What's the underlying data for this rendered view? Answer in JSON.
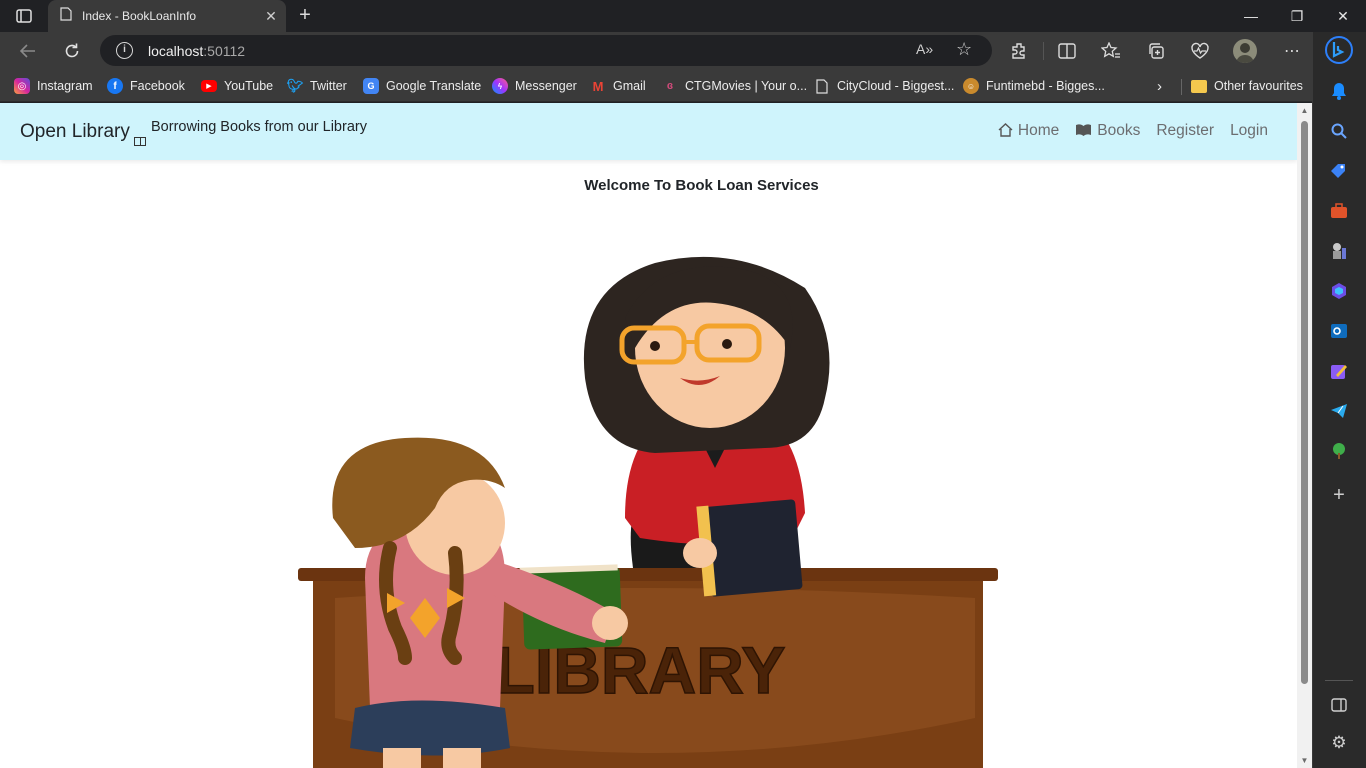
{
  "browser": {
    "tab": {
      "title": "Index - BookLoanInfo",
      "close": "✕"
    },
    "new_tab": "+",
    "window_controls": {
      "minimize": "—",
      "maximize": "❐",
      "close": "✕"
    },
    "address": {
      "host": "localhost",
      "port": ":50112",
      "read_aloud": "A»",
      "favorite": "☆"
    },
    "bookmarks": [
      {
        "label": "Instagram",
        "icon": "instagram-icon",
        "color": "#d6249f"
      },
      {
        "label": "Facebook",
        "icon": "facebook-icon",
        "color": "#1877f2"
      },
      {
        "label": "YouTube",
        "icon": "youtube-icon",
        "color": "#ff0000"
      },
      {
        "label": "Twitter",
        "icon": "twitter-icon",
        "color": "#1da1f2"
      },
      {
        "label": "Google Translate",
        "icon": "google-translate-icon",
        "color": "#4285f4"
      },
      {
        "label": "Messenger",
        "icon": "messenger-icon",
        "color": "#a033ff"
      },
      {
        "label": "Gmail",
        "icon": "gmail-icon",
        "color": "#ea4335"
      },
      {
        "label": "CTGMovies | Your o...",
        "icon": "ctgmovies-icon",
        "color": "#d04a7a"
      },
      {
        "label": "CityCloud - Biggest...",
        "icon": "page-icon",
        "color": "#3a3a3a"
      },
      {
        "label": "Funtimebd - Bigges...",
        "icon": "funtimebd-icon",
        "color": "#c98a2d"
      }
    ],
    "other_favourites": "Other favourites"
  },
  "page": {
    "brand": "Open Library",
    "tagline": "Borrowing Books from our Library",
    "nav": [
      {
        "label": "Home",
        "icon": "home-icon"
      },
      {
        "label": "Books",
        "icon": "book-icon"
      },
      {
        "label": "Register",
        "icon": ""
      },
      {
        "label": "Login",
        "icon": ""
      }
    ],
    "welcome": "Welcome To Book Loan Services",
    "illustration": {
      "desk_text": "LIBRARY",
      "colors": {
        "desk": "#7a3f14",
        "desk_top": "#5a2c0c",
        "librarian_jacket": "#c91f25",
        "girl_sweater": "#d9787f",
        "book_green": "#2e6b1e",
        "book_dark": "#1f2330"
      }
    }
  },
  "theme": {
    "navbar_bg": "#cff4fc",
    "browser_dark": "#202124",
    "browser_mid": "#3a3a3a"
  }
}
